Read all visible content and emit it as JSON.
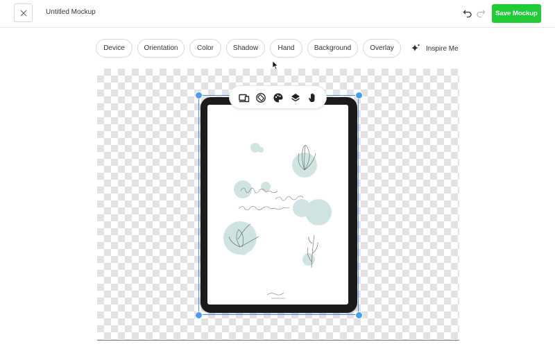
{
  "header": {
    "title": "Untitled Mockup",
    "save_label": "Save Mockup",
    "accent_color": "#1fcc36",
    "icons": {
      "close": "close-icon",
      "undo": "undo-icon",
      "redo": "redo-icon"
    }
  },
  "options": {
    "chips": [
      "Device",
      "Orientation",
      "Color",
      "Shadow",
      "Hand",
      "Background",
      "Overlay"
    ],
    "inspire_label": "Inspire Me",
    "inspire_icon": "sparkle-icon"
  },
  "floating_toolbar": {
    "icons": [
      "devices-icon",
      "rotate-icon",
      "palette-icon",
      "layers-icon",
      "hand-icon"
    ]
  },
  "canvas": {
    "device": "tablet",
    "selection_color": "#4a90e2"
  }
}
